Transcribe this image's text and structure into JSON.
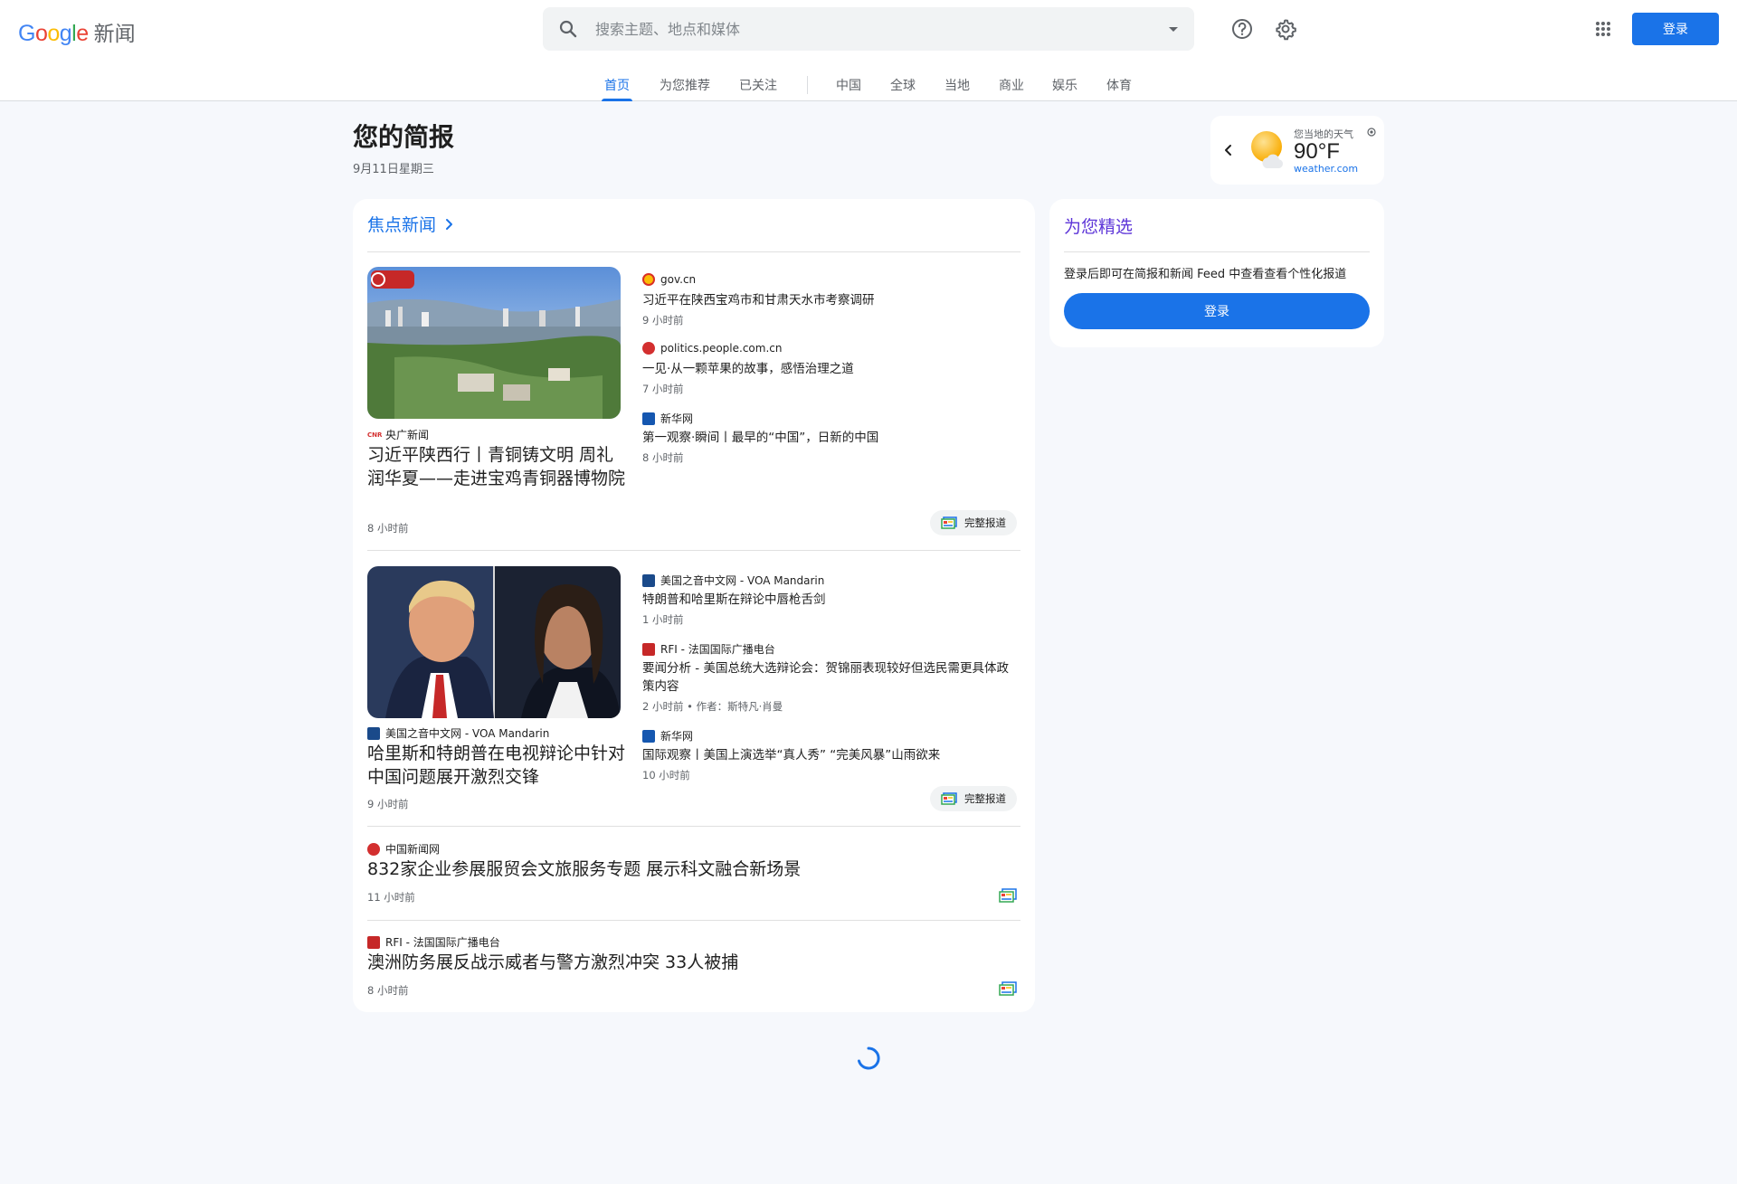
{
  "header": {
    "logo_google": "Google",
    "logo_news": "新闻",
    "search_placeholder": "搜索主题、地点和媒体",
    "signin": "登录"
  },
  "tabs": [
    {
      "label": "首页",
      "active": true
    },
    {
      "label": "为您推荐"
    },
    {
      "label": "已关注"
    },
    {
      "label": "中国"
    },
    {
      "label": "全球"
    },
    {
      "label": "当地"
    },
    {
      "label": "商业"
    },
    {
      "label": "娱乐"
    },
    {
      "label": "体育"
    }
  ],
  "briefing": {
    "title": "您的简报",
    "date": "9月11日星期三"
  },
  "weather": {
    "label": "您当地的天气",
    "temp": "90°F",
    "source": "weather.com"
  },
  "top_stories": {
    "heading": "焦点新闻",
    "clusters": [
      {
        "main": {
          "source": "央广新闻",
          "title": "习近平陕西行丨青铜铸文明 周礼润华夏——走进宝鸡青铜器博物院",
          "time": "8 小时前"
        },
        "related": [
          {
            "source": "gov.cn",
            "title": "习近平在陕西宝鸡市和甘肃天水市考察调研",
            "time": "9 小时前"
          },
          {
            "source": "politics.people.com.cn",
            "title": "一见·从一颗苹果的故事，感悟治理之道",
            "time": "7 小时前"
          },
          {
            "source": "新华网",
            "title": "第一观察·瞬间丨最早的“中国”，日新的中国",
            "time": "8 小时前"
          }
        ],
        "full_coverage": "完整报道"
      },
      {
        "main": {
          "source": "美国之音中文网 - VOA Mandarin",
          "title": "哈里斯和特朗普在电视辩论中针对中国问题展开激烈交锋",
          "time": "9 小时前"
        },
        "related": [
          {
            "source": "美国之音中文网 - VOA Mandarin",
            "title": "特朗普和哈里斯在辩论中唇枪舌剑",
            "time": "1 小时前"
          },
          {
            "source": "RFI - 法国国际广播电台",
            "title": "要闻分析 - 美国总统大选辩论会：贺锦丽表现较好但选民需更具体政策内容",
            "time": "2 小时前 • 作者：斯特凡·肖曼"
          },
          {
            "source": "新华网",
            "title": "国际观察丨美国上演选举“真人秀”  “完美风暴”山雨欲来",
            "time": "10 小时前"
          }
        ],
        "full_coverage": "完整报道"
      }
    ],
    "singles": [
      {
        "source": "中国新闻网",
        "title": "832家企业参展服贸会文旅服务专题 展示科文融合新场景",
        "time": "11 小时前"
      },
      {
        "source": "RFI - 法国国际广播电台",
        "title": "澳洲防务展反战示威者与警方激烈冲突 33人被捕",
        "time": "8 小时前"
      }
    ]
  },
  "picks": {
    "heading": "为您精选",
    "text": "登录后即可在简报和新闻 Feed 中查看查看个性化报道",
    "button": "登录"
  },
  "colors": {
    "accent": "#1a73e8",
    "picks_heading": "#5d35d8",
    "background": "#f6f8fc"
  }
}
